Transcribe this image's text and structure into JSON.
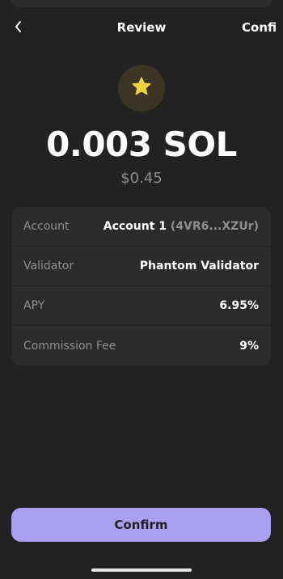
{
  "header": {
    "title": "Review",
    "action_label": "Confi"
  },
  "token": {
    "icon": "star-icon",
    "amount": "0.003 SOL",
    "fiat": "$0.45"
  },
  "details": [
    {
      "label": "Account",
      "value": "Account 1",
      "secondary": "(4VR6...XZUr)"
    },
    {
      "label": "Validator",
      "value": "Phantom Validator"
    },
    {
      "label": "APY",
      "value": "6.95%"
    },
    {
      "label": "Commission Fee",
      "value": "9%"
    }
  ],
  "footer": {
    "confirm_label": "Confirm"
  },
  "colors": {
    "background": "#222222",
    "card": "#2b2b2b",
    "accent": "#ab9ff2",
    "star": "#f5d33c",
    "muted_text": "#8f8f8f"
  }
}
